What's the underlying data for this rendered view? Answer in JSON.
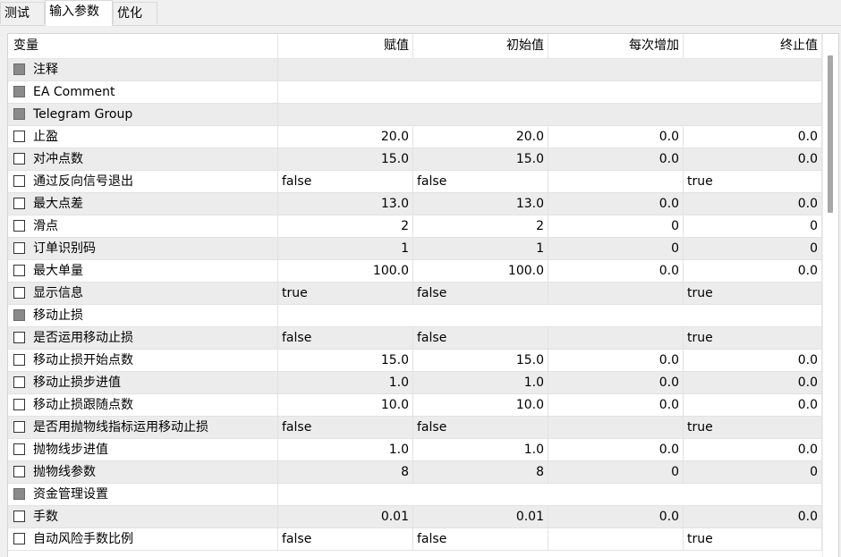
{
  "tabs": [
    {
      "label": "测试",
      "active": false
    },
    {
      "label": "输入参数",
      "active": true
    },
    {
      "label": "优化",
      "active": false
    }
  ],
  "table": {
    "headers": [
      "变量",
      "赋值",
      "初始值",
      "每次增加",
      "终止值"
    ],
    "rows": [
      {
        "name": "注释",
        "group": true,
        "values": [
          "",
          "",
          "",
          ""
        ]
      },
      {
        "name": "EA Comment",
        "group": true,
        "values": [
          "",
          "",
          "",
          ""
        ]
      },
      {
        "name": "Telegram Group",
        "group": true,
        "values": [
          "",
          "",
          "",
          ""
        ]
      },
      {
        "name": "止盈",
        "group": false,
        "align": "right",
        "values": [
          "20.0",
          "20.0",
          "0.0",
          "0.0"
        ]
      },
      {
        "name": "对冲点数",
        "group": false,
        "align": "right",
        "values": [
          "15.0",
          "15.0",
          "0.0",
          "0.0"
        ]
      },
      {
        "name": "通过反向信号退出",
        "group": false,
        "align": "left",
        "values": [
          "false",
          "false",
          "",
          "true"
        ]
      },
      {
        "name": "最大点差",
        "group": false,
        "align": "right",
        "values": [
          "13.0",
          "13.0",
          "0.0",
          "0.0"
        ]
      },
      {
        "name": "滑点",
        "group": false,
        "align": "right",
        "values": [
          "2",
          "2",
          "0",
          "0"
        ]
      },
      {
        "name": "订单识别码",
        "group": false,
        "align": "right",
        "values": [
          "1",
          "1",
          "0",
          "0"
        ]
      },
      {
        "name": "最大单量",
        "group": false,
        "align": "right",
        "values": [
          "100.0",
          "100.0",
          "0.0",
          "0.0"
        ]
      },
      {
        "name": "显示信息",
        "group": false,
        "align": "left",
        "values": [
          "true",
          "false",
          "",
          "true"
        ]
      },
      {
        "name": "移动止损",
        "group": true,
        "values": [
          "",
          "",
          "",
          ""
        ]
      },
      {
        "name": "是否运用移动止损",
        "group": false,
        "align": "left",
        "values": [
          "false",
          "false",
          "",
          "true"
        ]
      },
      {
        "name": "移动止损开始点数",
        "group": false,
        "align": "right",
        "values": [
          "15.0",
          "15.0",
          "0.0",
          "0.0"
        ]
      },
      {
        "name": "移动止损步进值",
        "group": false,
        "align": "right",
        "values": [
          "1.0",
          "1.0",
          "0.0",
          "0.0"
        ]
      },
      {
        "name": "移动止损跟随点数",
        "group": false,
        "align": "right",
        "values": [
          "10.0",
          "10.0",
          "0.0",
          "0.0"
        ]
      },
      {
        "name": "是否用抛物线指标运用移动止损",
        "group": false,
        "align": "left",
        "values": [
          "false",
          "false",
          "",
          "true"
        ]
      },
      {
        "name": "抛物线步进值",
        "group": false,
        "align": "right",
        "values": [
          "1.0",
          "1.0",
          "0.0",
          "0.0"
        ]
      },
      {
        "name": "抛物线参数",
        "group": false,
        "align": "right",
        "values": [
          "8",
          "8",
          "0",
          "0"
        ]
      },
      {
        "name": "资金管理设置",
        "group": true,
        "values": [
          "",
          "",
          "",
          ""
        ]
      },
      {
        "name": "手数",
        "group": false,
        "align": "right",
        "values": [
          "0.01",
          "0.01",
          "0.0",
          "0.0"
        ]
      },
      {
        "name": "自动风险手数比例",
        "group": false,
        "align": "left",
        "values": [
          "false",
          "false",
          "",
          "true"
        ]
      }
    ]
  }
}
